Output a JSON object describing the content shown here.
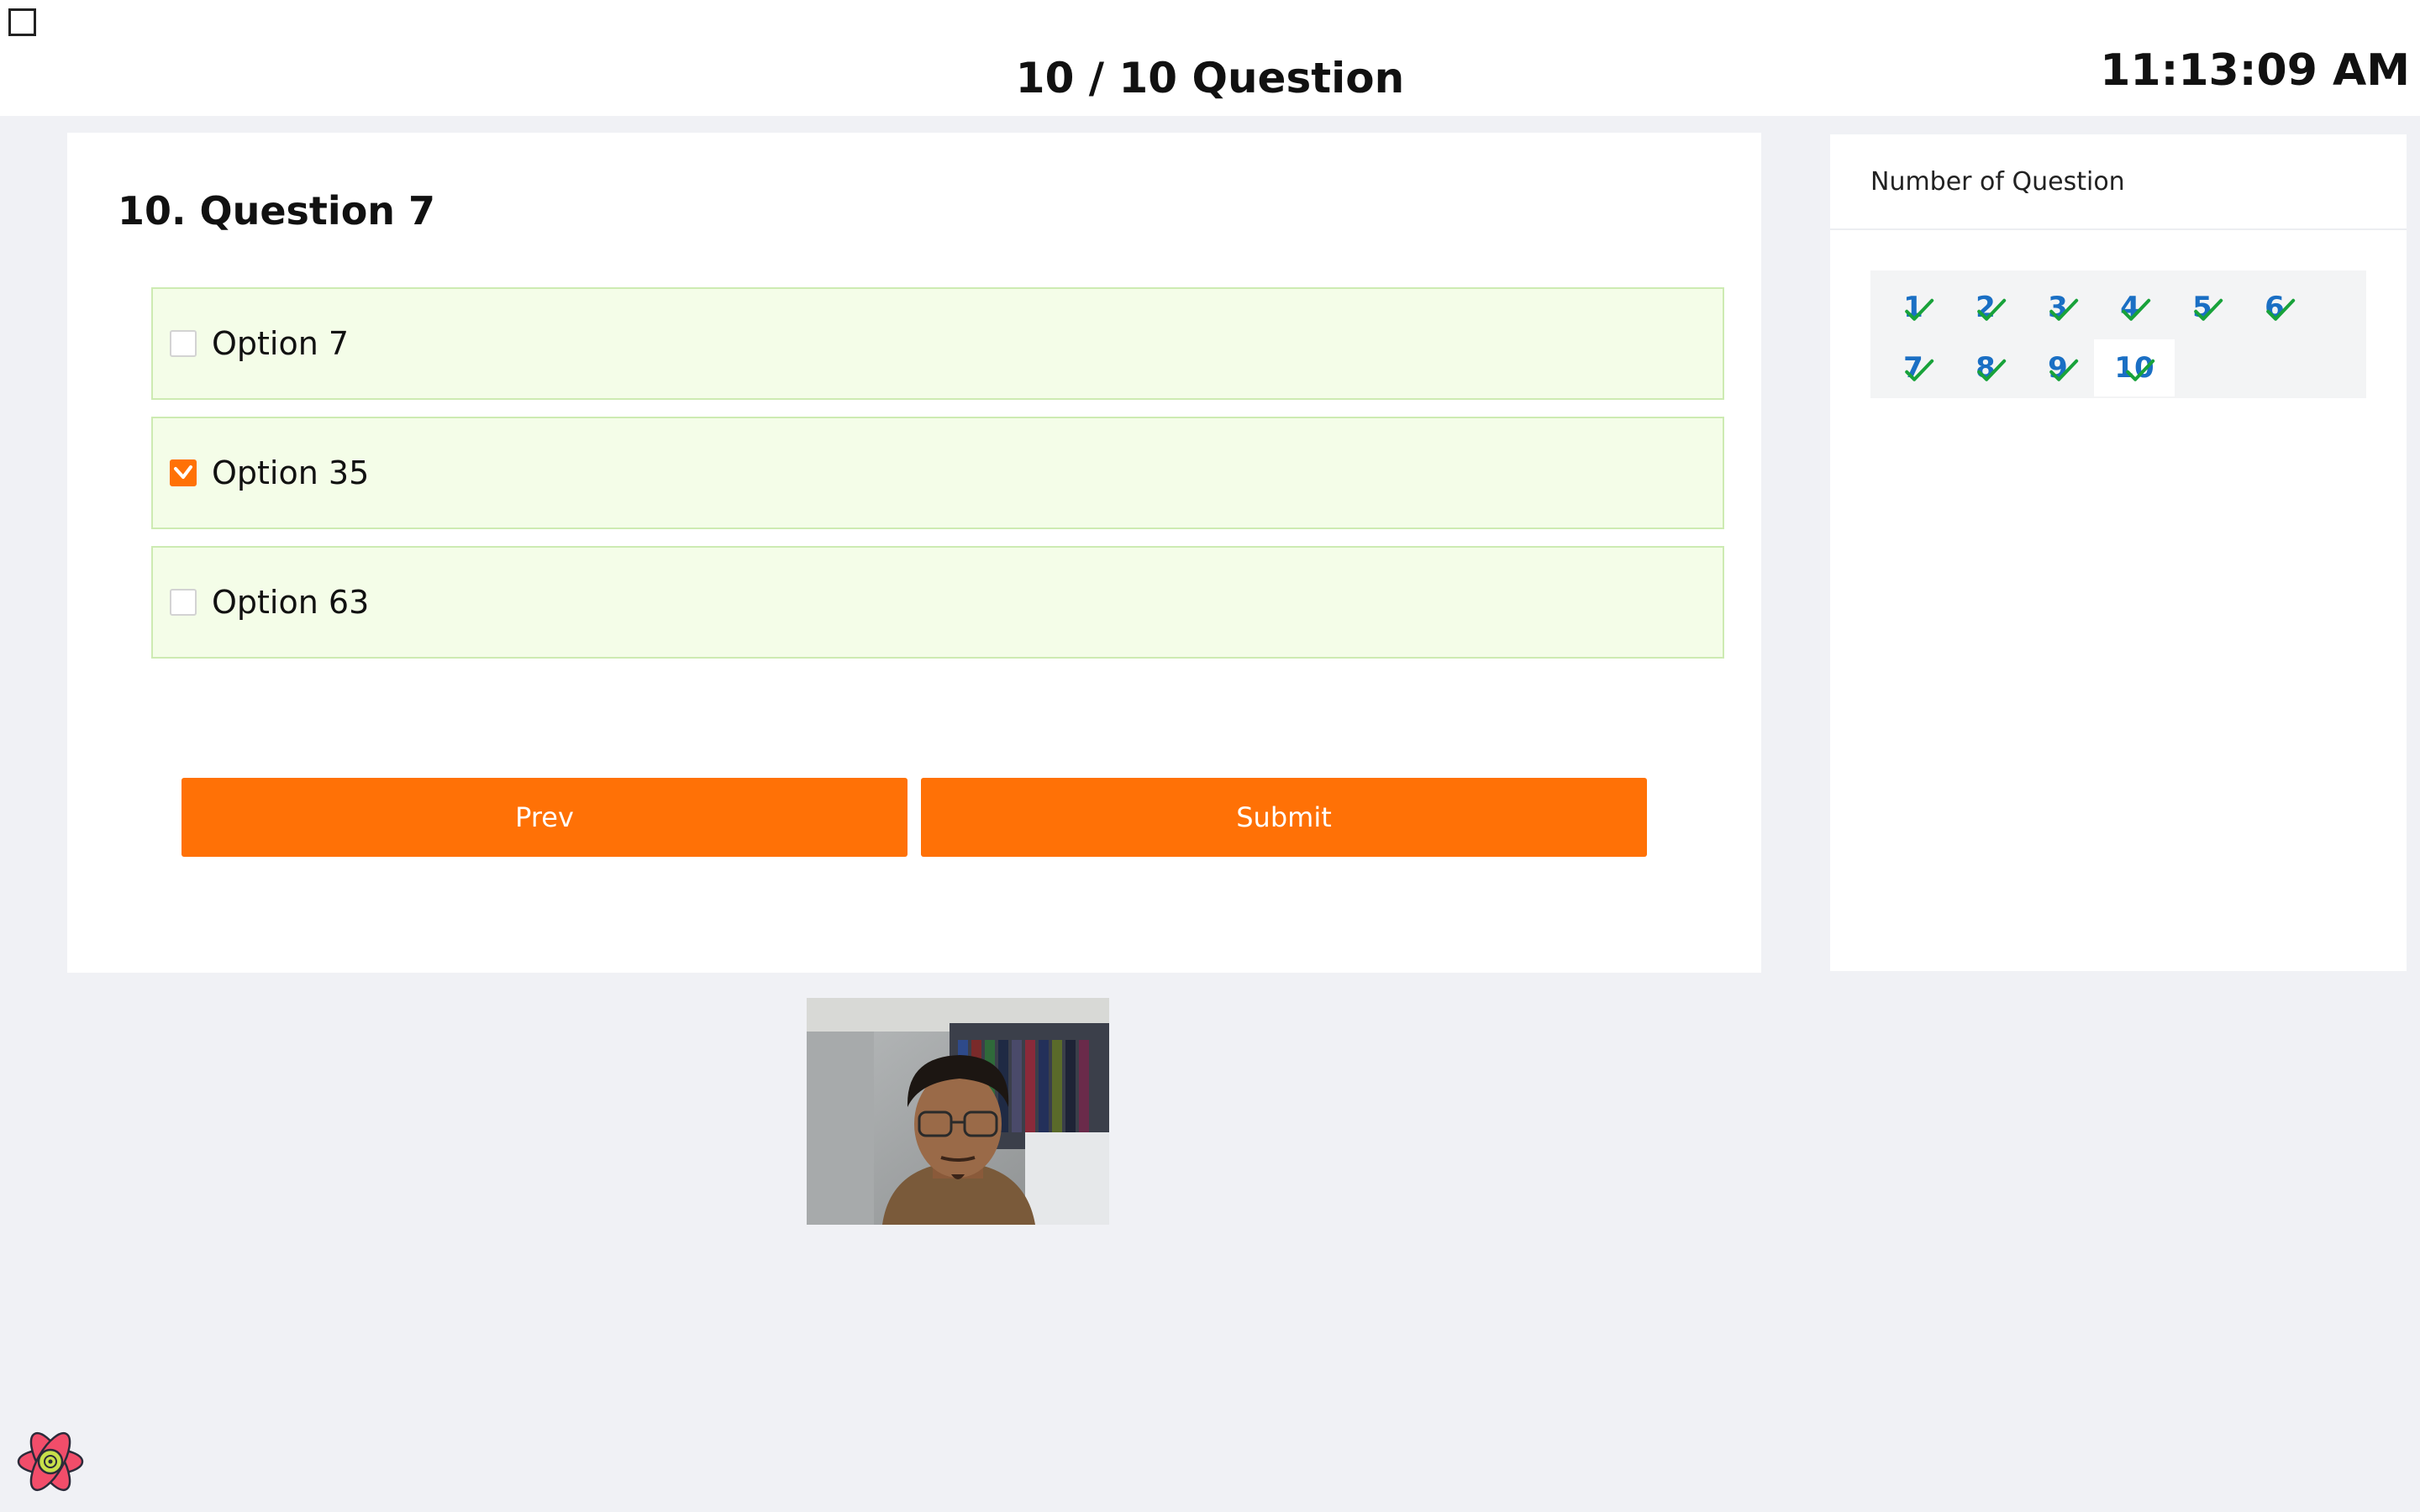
{
  "header": {
    "title": "10 / 10 Question",
    "clock": "11:13:09 AM"
  },
  "question": {
    "title": "10. Question 7",
    "options": [
      {
        "label": "Option 7",
        "checked": false
      },
      {
        "label": "Option 35",
        "checked": true
      },
      {
        "label": "Option 63",
        "checked": false
      }
    ],
    "prev_label": "Prev",
    "submit_label": "Submit"
  },
  "navigator": {
    "title": "Number of Question",
    "items": [
      {
        "label": "1",
        "answered": true,
        "current": false
      },
      {
        "label": "2",
        "answered": true,
        "current": false
      },
      {
        "label": "3",
        "answered": true,
        "current": false
      },
      {
        "label": "4",
        "answered": true,
        "current": false
      },
      {
        "label": "5",
        "answered": true,
        "current": false
      },
      {
        "label": "6",
        "answered": true,
        "current": false
      },
      {
        "label": "7",
        "answered": true,
        "current": false
      },
      {
        "label": "8",
        "answered": true,
        "current": false
      },
      {
        "label": "9",
        "answered": true,
        "current": false
      },
      {
        "label": "10",
        "answered": true,
        "current": true
      }
    ]
  },
  "colors": {
    "accent": "#ff7106",
    "option_bg": "#f4fde8",
    "number_blue": "#1a6fc4",
    "check_green": "#18a23a"
  },
  "icons": {
    "corner": "square-outline-icon",
    "checkmark": "check-icon",
    "logo": "react-atom-icon"
  }
}
